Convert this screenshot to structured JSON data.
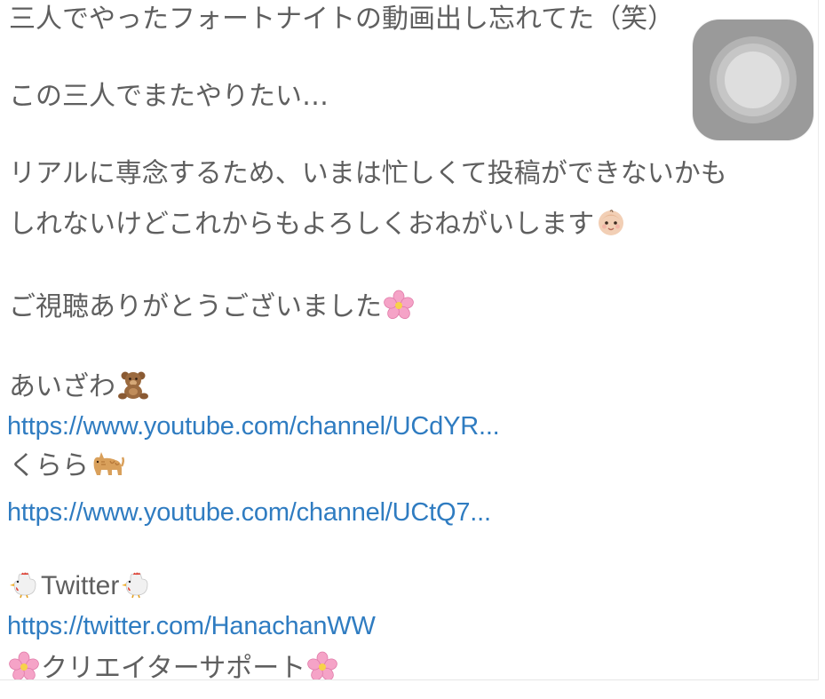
{
  "description": {
    "line1": "三人でやったフォートナイトの動画出し忘れてた（笑）",
    "line2": "この三人でまたやりたい…",
    "line3a": "リアルに専念するため、いまは忙しくて投稿ができないかも",
    "line3b": "しれないけどこれからもよろしくおねがいします",
    "line4": "ご視聴ありがとうございました",
    "aizawa_label": "あいざわ",
    "aizawa_link": "https://www.youtube.com/channel/UCdYR...",
    "kurara_label": "くらら",
    "kurara_link": "https://www.youtube.com/channel/UCtQ7...",
    "twitter_label": "Twitter",
    "twitter_link": "https://twitter.com/HanachanWW",
    "creator_support_label": "クリエイターサポート"
  },
  "icons": {
    "baby": "baby-face-icon",
    "cherry_blossom": "cherry-blossom-icon",
    "teddy_bear": "teddy-bear-icon",
    "cat": "cat-icon",
    "rooster": "rooster-icon",
    "assistive_touch": "assistive-touch-icon"
  },
  "colors": {
    "text": "#5f5f5f",
    "link": "#2f7cc1",
    "assistive_touch": "#9a9a9a"
  }
}
